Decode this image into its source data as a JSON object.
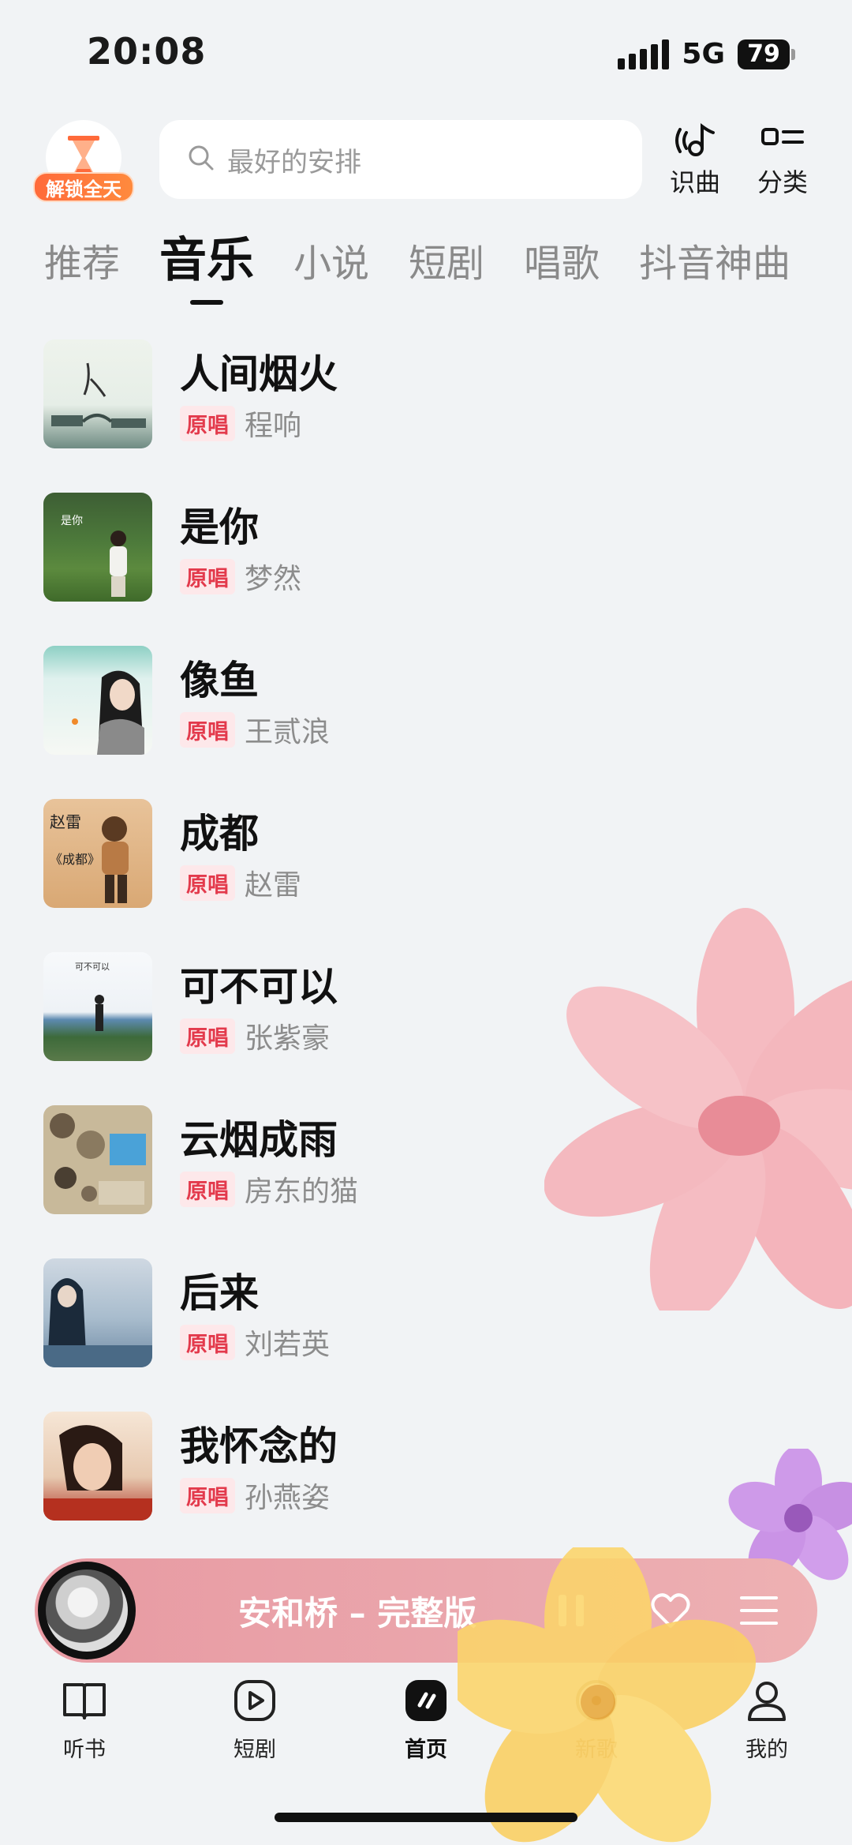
{
  "status_bar": {
    "time": "20:08",
    "network": "5G",
    "battery": "79"
  },
  "header": {
    "timer_badge_label": "解锁全天",
    "search_placeholder": "最好的安排",
    "actions": [
      {
        "label": "识曲",
        "icon": "music-recognize-icon"
      },
      {
        "label": "分类",
        "icon": "category-icon"
      }
    ]
  },
  "tabs": [
    {
      "label": "推荐",
      "active": false
    },
    {
      "label": "音乐",
      "active": true
    },
    {
      "label": "小说",
      "active": false
    },
    {
      "label": "短剧",
      "active": false
    },
    {
      "label": "唱歌",
      "active": false
    },
    {
      "label": "抖音神曲",
      "active": false
    }
  ],
  "songs": [
    {
      "title": "人间烟火",
      "tag": "原唱",
      "artist": "程响"
    },
    {
      "title": "是你",
      "tag": "原唱",
      "artist": "梦然"
    },
    {
      "title": "像鱼",
      "tag": "原唱",
      "artist": "王贰浪"
    },
    {
      "title": "成都",
      "tag": "原唱",
      "artist": "赵雷"
    },
    {
      "title": "可不可以",
      "tag": "原唱",
      "artist": "张紫豪"
    },
    {
      "title": "云烟成雨",
      "tag": "原唱",
      "artist": "房东的猫"
    },
    {
      "title": "后来",
      "tag": "原唱",
      "artist": "刘若英"
    },
    {
      "title": "我怀念的",
      "tag": "原唱",
      "artist": "孙燕姿"
    }
  ],
  "player": {
    "now_playing": "安和桥 – 完整版"
  },
  "bottom_nav": [
    {
      "label": "听书",
      "icon": "book-icon",
      "active": false
    },
    {
      "label": "短剧",
      "icon": "play-icon",
      "active": false
    },
    {
      "label": "首页",
      "icon": "home-icon",
      "active": true
    },
    {
      "label": "新歌",
      "icon": "disc-icon",
      "active": false
    },
    {
      "label": "我的",
      "icon": "profile-icon",
      "active": false
    }
  ],
  "colors": {
    "background": "#f1f3f5",
    "tag_text": "#e33a4c",
    "tag_bg": "#fde8ea",
    "player_bar": "#e89aa2",
    "timer_badge": "#ff6a3a"
  }
}
